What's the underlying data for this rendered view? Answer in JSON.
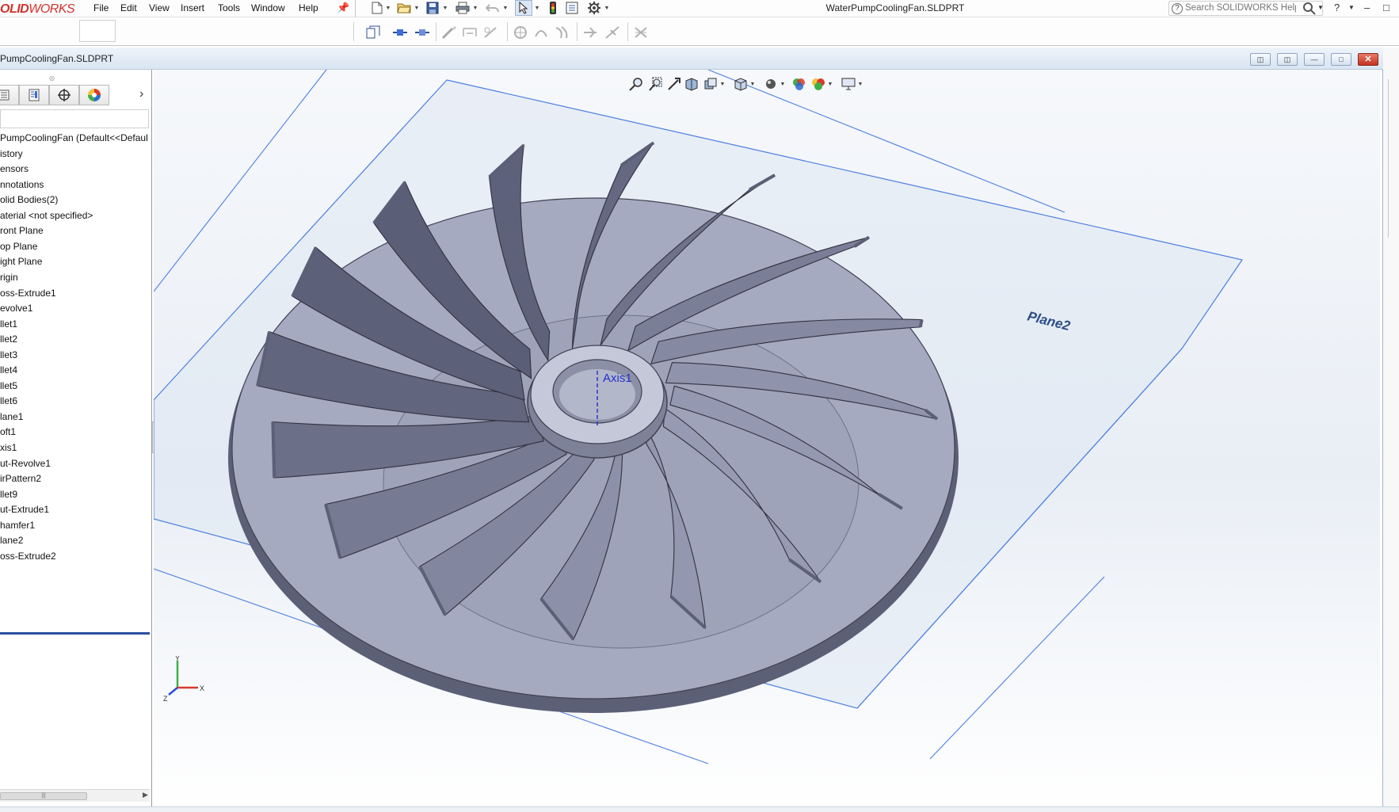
{
  "app": {
    "logo_bold": "OLID",
    "logo_thin": "WORKS",
    "menu": [
      "File",
      "Edit",
      "View",
      "Insert",
      "Tools",
      "Window",
      "Help"
    ],
    "document_title": "WaterPumpCoolingFan.SLDPRT"
  },
  "search": {
    "placeholder": "Search SOLIDWORKS Help"
  },
  "document_window": {
    "title": "PumpCoolingFan.SLDPRT",
    "controls": [
      "tile-left",
      "tile-right",
      "minimize",
      "restore",
      "close"
    ]
  },
  "feature_manager": {
    "tabs": [
      "feature-tree",
      "property-manager",
      "configuration-manager",
      "display-manager"
    ],
    "tree": [
      "PumpCoolingFan  (Default<<Defaul",
      "istory",
      "ensors",
      "nnotations",
      "olid Bodies(2)",
      "aterial <not specified>",
      "ront Plane",
      "op Plane",
      "ight Plane",
      "rigin",
      "oss-Extrude1",
      "evolve1",
      "llet1",
      "llet2",
      "llet3",
      "llet4",
      "llet5",
      "llet6",
      "lane1",
      "oft1",
      "xis1",
      "ut-Revolve1",
      "irPattern2",
      "llet9",
      "ut-Extrude1",
      "hamfer1",
      "lane2",
      "oss-Extrude2"
    ]
  },
  "graphics": {
    "plane_label": "Plane2",
    "axis_label": "Axis1",
    "triad_labels": {
      "x": "X",
      "y": "Y",
      "z": "Z"
    },
    "colors": {
      "part": "#a9adc4",
      "part_dark": "#5c6076",
      "plane_edge": "#3a6fd6",
      "axis": "#2130c9"
    }
  },
  "icons": {
    "toolbar": [
      "new-document-icon",
      "open-icon",
      "save-icon",
      "print-icon",
      "undo-icon",
      "select-icon",
      "rebuild-icon",
      "file-properties-icon",
      "options-icon"
    ],
    "heads_up": [
      "zoom-to-fit-icon",
      "zoom-to-area-icon",
      "previous-view-icon",
      "section-view-icon",
      "dynamic-annotation-icon",
      "view-orientation-icon",
      "display-style-icon",
      "hide-show-icon",
      "edit-appearance-icon",
      "scene-icon",
      "view-settings-icon"
    ]
  }
}
